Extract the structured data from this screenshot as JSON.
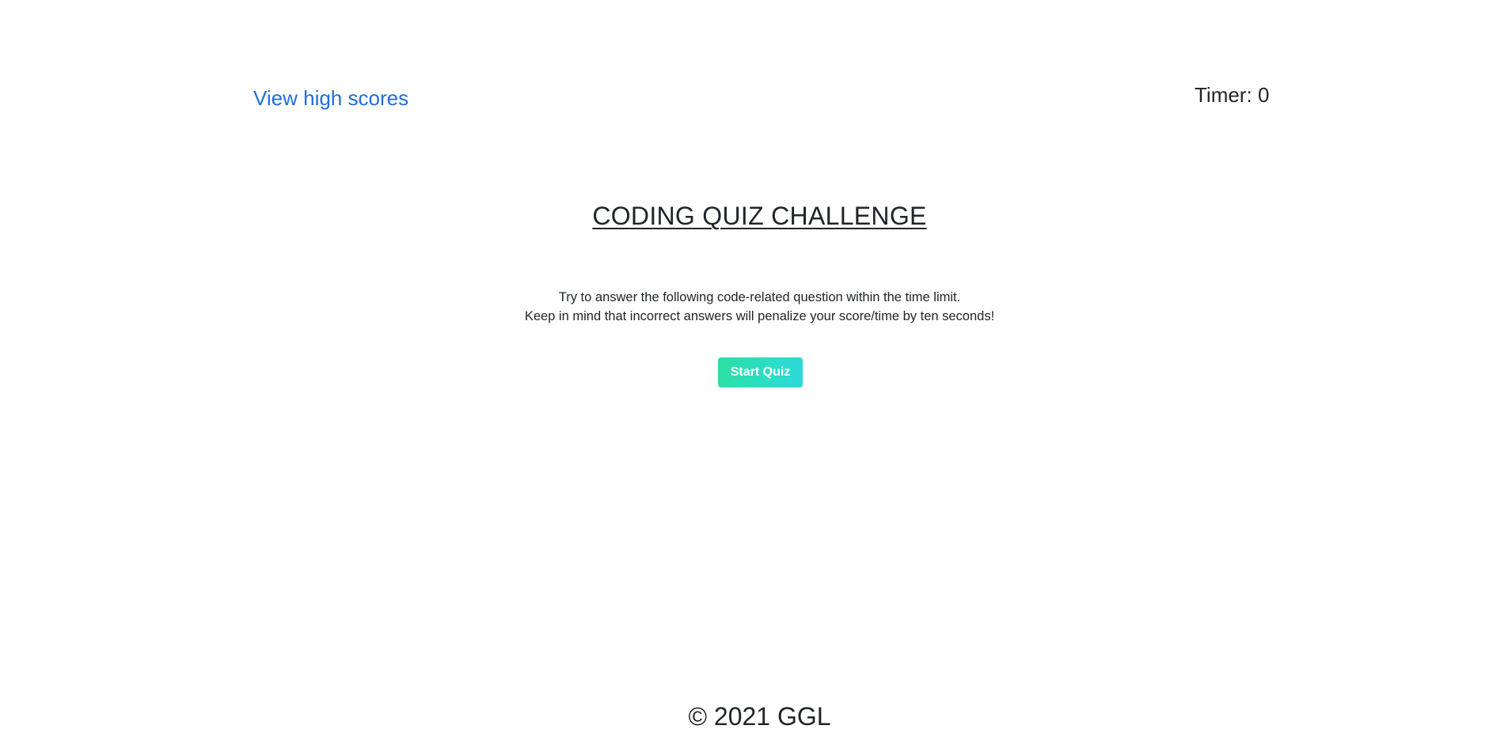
{
  "header": {
    "highscores_link": "View high scores",
    "timer_label": "Timer:",
    "timer_value": "0"
  },
  "main": {
    "title": "CODING QUIZ CHALLENGE",
    "instructions": [
      "Try to answer the following code-related question within the time limit.",
      "Keep in mind that incorrect answers will penalize your score/time by ten seconds!"
    ],
    "start_button": "Start Quiz"
  },
  "footer": {
    "copyright": "© 2021 GGL"
  },
  "colors": {
    "link": "#1e6fe0",
    "text": "#212529",
    "button_gradient_start": "#2de0a6",
    "button_gradient_end": "#2bd9d9",
    "background": "#ffffff"
  }
}
